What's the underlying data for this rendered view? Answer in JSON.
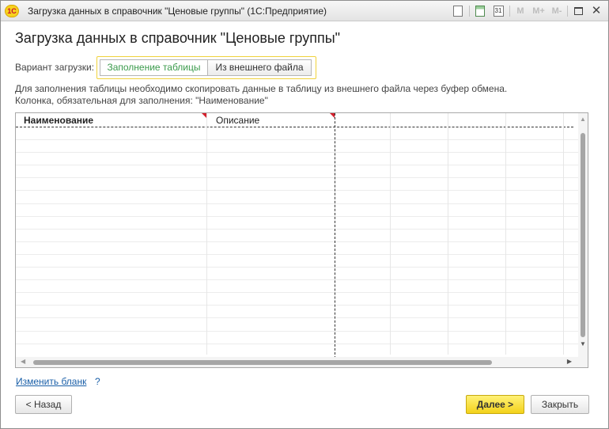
{
  "window": {
    "title": "Загрузка данных в справочник \"Ценовые группы\"  (1С:Предприятие)",
    "logo_text": "1С"
  },
  "titlebar_icons": {
    "calendar_day": "31",
    "m": "M",
    "m_plus": "M+",
    "m_minus": "M-",
    "close": "✕"
  },
  "page": {
    "title": "Загрузка данных в справочник \"Ценовые группы\""
  },
  "variant": {
    "label": "Вариант загрузки:",
    "options": [
      "Заполнение таблицы",
      "Из внешнего файла"
    ],
    "selected": "Заполнение таблицы"
  },
  "info": {
    "line1": "Для заполнения таблицы необходимо скопировать данные в таблицу из внешнего файла через буфер обмена.",
    "line2": "Колонка, обязательная для заполнения: \"Наименование\""
  },
  "table": {
    "columns": [
      "Наименование",
      "Описание"
    ],
    "rows": []
  },
  "links": {
    "change_form": "Изменить бланк",
    "help": "?"
  },
  "buttons": {
    "back": "< Назад",
    "next": "Далее >",
    "close": "Закрыть"
  },
  "colors": {
    "accent_yellow": "#f3d21b",
    "active_option_green": "#3a9a4b",
    "link_blue": "#1a5fa8",
    "required_marker_red": "#d4202c"
  }
}
